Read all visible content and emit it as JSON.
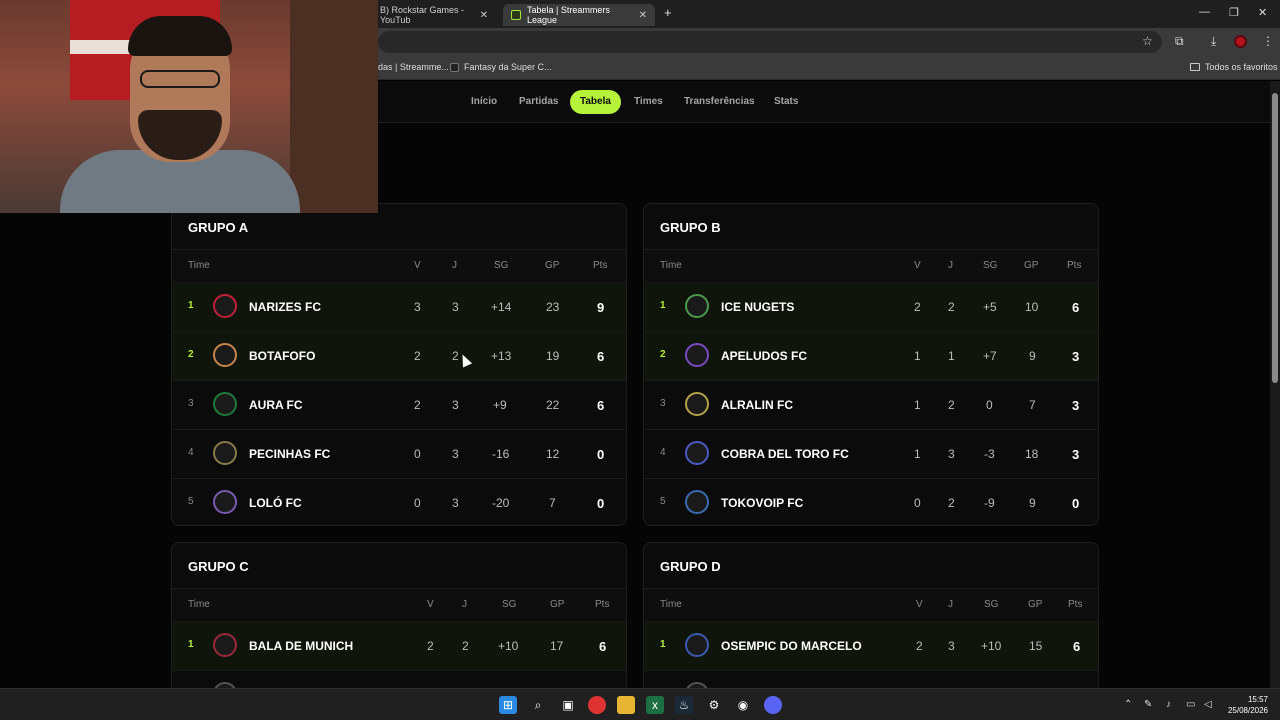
{
  "browser": {
    "tabs": [
      {
        "label": "B) Rockstar Games - YouTub",
        "active": false
      },
      {
        "label": "Tabela | Streammers League",
        "active": true
      }
    ],
    "new_tab": "+",
    "bookmarks": [
      {
        "label": "das | Streamme..."
      },
      {
        "label": "Fantasy da Super C..."
      }
    ],
    "all_favorites": "Todos os favoritos"
  },
  "nav": {
    "items": [
      {
        "label": "Início",
        "active": false
      },
      {
        "label": "Partidas",
        "active": false
      },
      {
        "label": "Tabela",
        "active": true
      },
      {
        "label": "Times",
        "active": false
      },
      {
        "label": "Transferências",
        "active": false
      },
      {
        "label": "Stats",
        "active": false
      }
    ]
  },
  "table_headers": {
    "team": "Time",
    "v": "V",
    "j": "J",
    "sg": "SG",
    "gp": "GP",
    "pts": "Pts"
  },
  "groups": [
    {
      "title": "GRUPO A",
      "rows": [
        {
          "pos": "1",
          "team": "NARIZES FC",
          "v": "3",
          "j": "3",
          "sg": "+14",
          "gp": "23",
          "pts": "9",
          "badge_color": "#c21f3a"
        },
        {
          "pos": "2",
          "team": "BOTAFOFO",
          "v": "2",
          "j": "2",
          "sg": "+13",
          "gp": "19",
          "pts": "6",
          "badge_color": "#c9844a"
        },
        {
          "pos": "3",
          "team": "AURA FC",
          "v": "2",
          "j": "3",
          "sg": "+9",
          "gp": "22",
          "pts": "6",
          "badge_color": "#1f7a3a"
        },
        {
          "pos": "4",
          "team": "PECINHAS FC",
          "v": "0",
          "j": "3",
          "sg": "-16",
          "gp": "12",
          "pts": "0",
          "badge_color": "#8a7a4a"
        },
        {
          "pos": "5",
          "team": "LOLÓ FC",
          "v": "0",
          "j": "3",
          "sg": "-20",
          "gp": "7",
          "pts": "0",
          "badge_color": "#7a5ab0"
        }
      ]
    },
    {
      "title": "GRUPO B",
      "rows": [
        {
          "pos": "1",
          "team": "ICE NUGETS",
          "v": "2",
          "j": "2",
          "sg": "+5",
          "gp": "10",
          "pts": "6",
          "badge_color": "#4a9a4a"
        },
        {
          "pos": "2",
          "team": "APELUDOS FC",
          "v": "1",
          "j": "1",
          "sg": "+7",
          "gp": "9",
          "pts": "3",
          "badge_color": "#7a4ac0"
        },
        {
          "pos": "3",
          "team": "ALRALIN FC",
          "v": "1",
          "j": "2",
          "sg": "0",
          "gp": "7",
          "pts": "3",
          "badge_color": "#b5a04a"
        },
        {
          "pos": "4",
          "team": "COBRA DEL TORO FC",
          "v": "1",
          "j": "3",
          "sg": "-3",
          "gp": "18",
          "pts": "3",
          "badge_color": "#4a5ac0"
        },
        {
          "pos": "5",
          "team": "TOKOVOIP FC",
          "v": "0",
          "j": "2",
          "sg": "-9",
          "gp": "9",
          "pts": "0",
          "badge_color": "#3a6ab0"
        }
      ]
    },
    {
      "title": "GRUPO C",
      "rows": [
        {
          "pos": "1",
          "team": "BALA DE MUNICH",
          "v": "2",
          "j": "2",
          "sg": "+10",
          "gp": "17",
          "pts": "6",
          "badge_color": "#9a2a3a"
        }
      ]
    },
    {
      "title": "GRUPO D",
      "rows": [
        {
          "pos": "1",
          "team": "OSEMPIC DO MARCELO",
          "v": "2",
          "j": "3",
          "sg": "+10",
          "gp": "15",
          "pts": "6",
          "badge_color": "#3a5ab0"
        }
      ]
    }
  ],
  "taskbar": {
    "time": "15:57",
    "date": "25/08/2026"
  },
  "colors": {
    "accent": "#b6f23a",
    "background": "#050505",
    "card": "#0b0b0b"
  }
}
